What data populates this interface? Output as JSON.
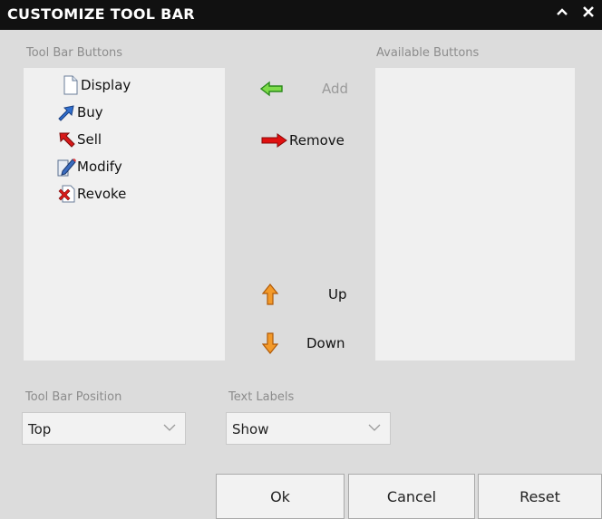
{
  "window": {
    "title": "CUSTOMIZE TOOL BAR",
    "collapse_icon": "chevron-up-icon",
    "close_icon": "close-icon"
  },
  "toolbar_buttons": {
    "label": "Tool Bar Buttons",
    "items": [
      {
        "label": "Display",
        "icon": "document-icon"
      },
      {
        "label": "Buy",
        "icon": "blue-arrow-icon"
      },
      {
        "label": "Sell",
        "icon": "red-arrow-icon"
      },
      {
        "label": "Modify",
        "icon": "edit-icon"
      },
      {
        "label": "Revoke",
        "icon": "revoke-icon"
      }
    ]
  },
  "available_buttons": {
    "label": "Available Buttons",
    "items": []
  },
  "actions": {
    "add": "Add",
    "remove": "Remove",
    "up": "Up",
    "down": "Down"
  },
  "position": {
    "label": "Tool Bar Position",
    "value": "Top"
  },
  "text_labels": {
    "label": "Text Labels",
    "value": "Show"
  },
  "footer": {
    "ok": "Ok",
    "cancel": "Cancel",
    "reset": "Reset"
  },
  "colors": {
    "titlebar": "#111111",
    "background": "#dcdcdc",
    "panel": "#f0f0f0",
    "add_arrow": "#3fb93f",
    "remove_arrow": "#e01010",
    "up_down_arrow": "#f08a1c"
  }
}
